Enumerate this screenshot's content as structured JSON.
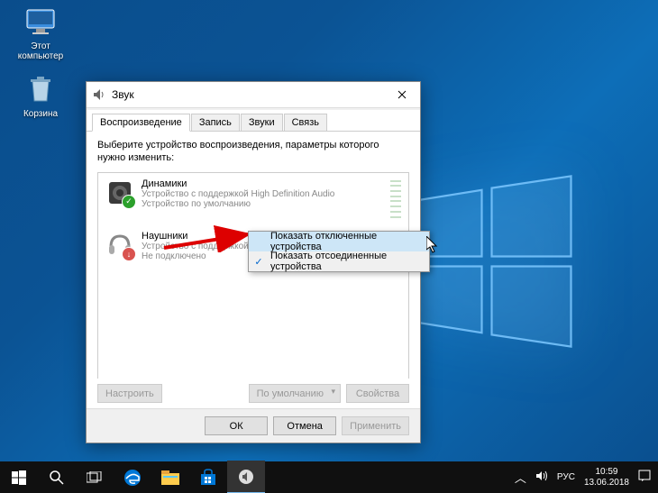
{
  "desktop": {
    "icons": [
      {
        "label": "Этот\nкомпьютер"
      },
      {
        "label": "Корзина"
      }
    ]
  },
  "dialog": {
    "title": "Звук",
    "tabs": [
      "Воспроизведение",
      "Запись",
      "Звуки",
      "Связь"
    ],
    "active_tab": 0,
    "instruction": "Выберите устройство воспроизведения, параметры которого нужно изменить:",
    "devices": [
      {
        "name": "Динамики",
        "desc": "Устройство с поддержкой High Definition Audio",
        "status": "Устройство по умолчанию",
        "badge": "ok"
      },
      {
        "name": "Наушники",
        "desc": "Устройство с поддержкой High Definition Audio",
        "status": "Не подключено",
        "badge": "down"
      }
    ],
    "buttons": {
      "configure": "Настроить",
      "set_default": "По умолчанию",
      "properties": "Свойства",
      "ok": "ОК",
      "cancel": "Отмена",
      "apply": "Применить"
    }
  },
  "context_menu": {
    "items": [
      {
        "label": "Показать отключенные устройства",
        "checked": false,
        "highlighted": true
      },
      {
        "label": "Показать отсоединенные устройства",
        "checked": true,
        "highlighted": false
      }
    ]
  },
  "taskbar": {
    "tray": {
      "lang": "РУС",
      "time": "10:59",
      "date": "13.06.2018"
    }
  }
}
